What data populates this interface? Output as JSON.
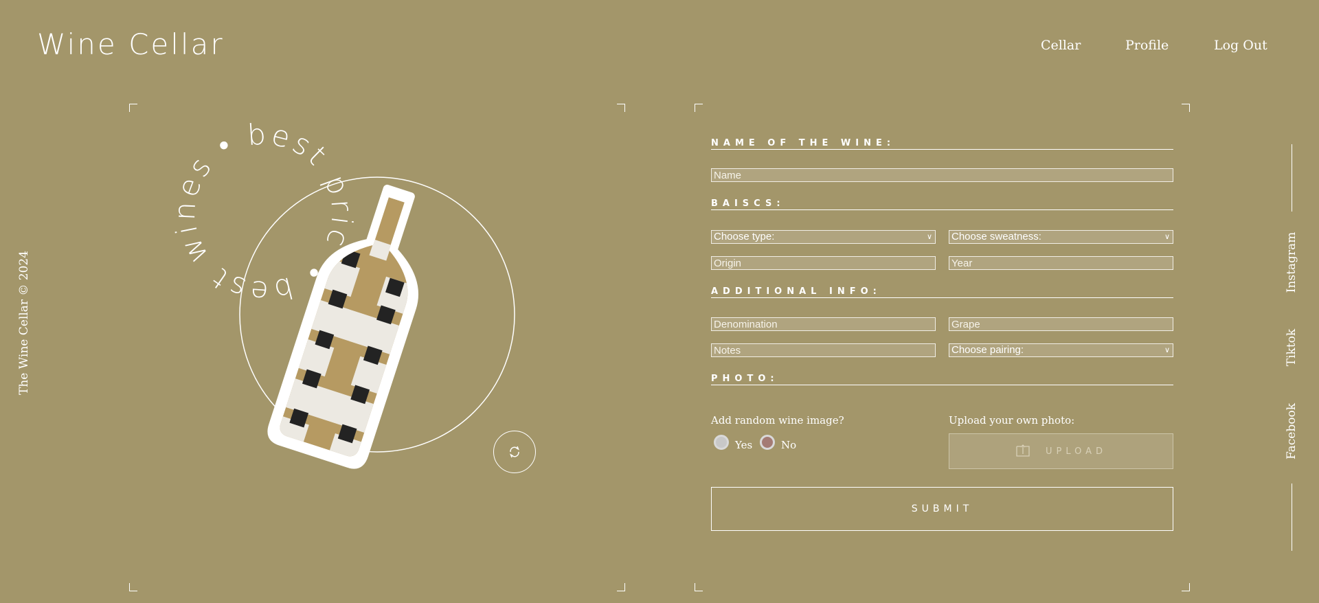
{
  "brand": {
    "title": "Wine Cellar"
  },
  "nav": {
    "items": [
      "Cellar",
      "Profile",
      "Log Out"
    ]
  },
  "footer": {
    "copyright": "The Wine Cellar © 2024"
  },
  "social": {
    "items": [
      "Instagram",
      "Tiktok",
      "Facebook"
    ]
  },
  "illustration": {
    "circular_text": "• best wines • best prices"
  },
  "form": {
    "sections": {
      "name": "NAME OF THE WINE:",
      "basics": "BAISCS:",
      "additional": "ADDITIONAL INFO:",
      "photo": "PHOTO:"
    },
    "name_placeholder": "Name",
    "type_select": "Choose type:",
    "sweetness_select": "Choose sweatness:",
    "origin_placeholder": "Origin",
    "year_placeholder": "Year",
    "denomination_placeholder": "Denomination",
    "grape_placeholder": "Grape",
    "notes_placeholder": "Notes",
    "pairing_select": "Choose pairing:",
    "random_image_label": "Add random wine image?",
    "yes_label": "Yes",
    "no_label": "No",
    "upload_label": "Upload your own photo:",
    "upload_button": "UPLOAD",
    "submit_button": "SUBMIT"
  },
  "colors": {
    "background": "#a3966a",
    "foreground": "#ffffff"
  },
  "icons": {
    "refresh": "refresh-icon",
    "upload": "upload-icon"
  }
}
